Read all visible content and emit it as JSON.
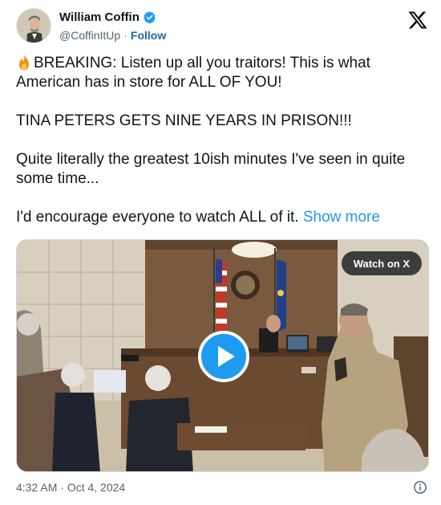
{
  "author": {
    "display_name": "William Coffin",
    "handle": "@CoffinItUp",
    "separator": "·",
    "follow_label": "Follow"
  },
  "tweet": {
    "line1": "BREAKING: Listen up all you traitors! This is what American has in store for ALL OF YOU!",
    "line2": "TINA PETERS GETS NINE YEARS IN PRISON!!!",
    "line3": "Quite literally the greatest 10ish minutes I've seen in quite some time...",
    "line4": "I'd encourage everyone to watch ALL of it.",
    "show_more": "Show more"
  },
  "media": {
    "watch_label": "Watch on X",
    "play_icon": "play-icon"
  },
  "footer": {
    "timestamp": "4:32 AM · Oct 4, 2024",
    "info_icon": "info-icon"
  },
  "icons": [
    "verified-badge-icon",
    "x-logo-icon",
    "fire-emoji-icon",
    "play-icon",
    "info-icon"
  ],
  "colors": {
    "accent": "#1d9bf0",
    "follow": "#1d67b8",
    "text": "#0f1419",
    "muted": "#536471"
  }
}
